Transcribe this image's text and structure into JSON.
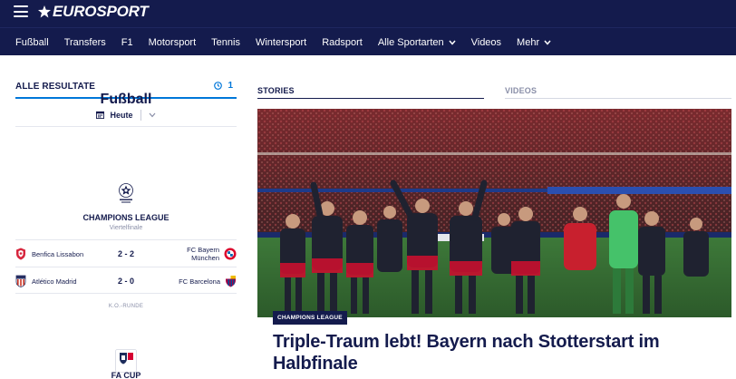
{
  "header": {
    "logo_text": "EUROSPORT"
  },
  "nav": {
    "items": [
      {
        "label": "Fußball"
      },
      {
        "label": "Transfers"
      },
      {
        "label": "F1"
      },
      {
        "label": "Motorsport"
      },
      {
        "label": "Tennis"
      },
      {
        "label": "Wintersport"
      },
      {
        "label": "Radsport"
      },
      {
        "label": "Alle Sportarten",
        "icon": "chevron-down-icon"
      },
      {
        "label": "Videos"
      },
      {
        "label": "Mehr",
        "icon": "chevron-down-icon"
      }
    ]
  },
  "results": {
    "tab_label": "ALLE RESULTATE",
    "live_count": "1",
    "live_icon": "clock-icon",
    "date_icon": "calendar-icon",
    "date_label": "Heute",
    "sport_title": "Fußball",
    "competition": {
      "logo_icon": "champions-league-logo",
      "name": "CHAMPIONS LEAGUE",
      "round": "Viertelfinale",
      "matches": [
        {
          "home": "Benfica Lissabon",
          "score": "2 - 2",
          "away": "FC Bayern München",
          "away_line1": "FC Bayern",
          "away_line2": "München"
        },
        {
          "home": "Atlético Madrid",
          "score": "2 - 0",
          "away": "FC Barcelona"
        }
      ],
      "stage_label": "K.O.-RUNDE"
    },
    "next_competition": {
      "logo_icon": "fa-cup-logo",
      "name": "FA CUP"
    }
  },
  "tabs": {
    "stories": "STORIES",
    "videos": "VIDEOS"
  },
  "hero": {
    "badge": "CHAMPIONS LEAGUE",
    "headline": "Triple-Traum lebt! Bayern nach Stotterstart im Halbfinale",
    "image": "bayern-players-celebrating-photo"
  },
  "colors": {
    "brand_navy": "#141b4d",
    "accent_blue": "#0077d9"
  }
}
